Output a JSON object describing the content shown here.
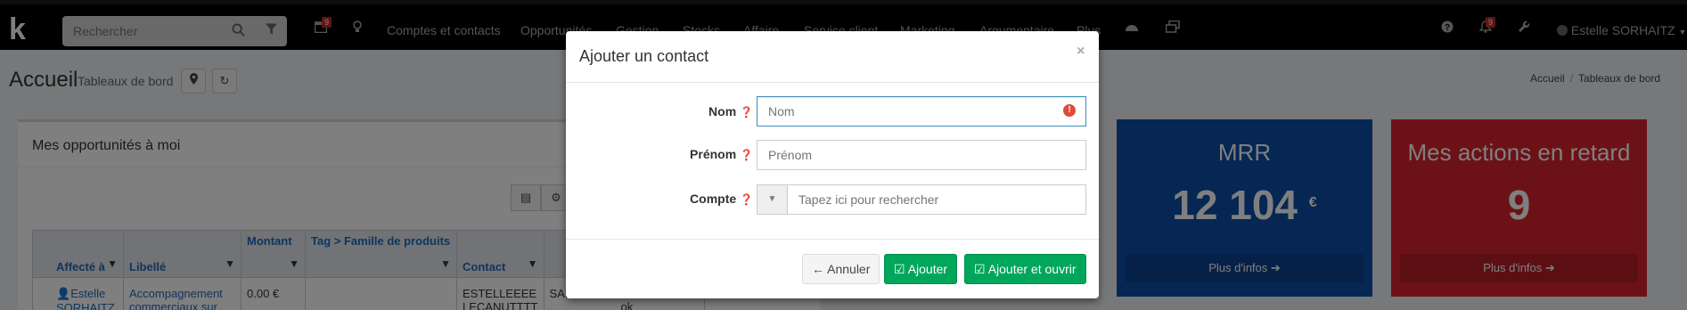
{
  "navbar": {
    "logo": "k",
    "search_placeholder": "Rechercher",
    "calendar_badge": "9",
    "menu": [
      "Comptes et contacts",
      "Opportunités",
      "Gestion",
      "Stocks",
      "Affaire",
      "Service client",
      "Marketing",
      "Argumentaire",
      "Plus"
    ],
    "notif_badge": "9",
    "user_name": "Estelle SORHAITZ"
  },
  "page": {
    "title": "Accueil",
    "subtitle": "Tableaux de bord",
    "breadcrumb": [
      "Accueil",
      "Tableaux de bord"
    ]
  },
  "opportunities_box": {
    "title": "Mes opportunités à moi",
    "columns": [
      "Affecté à",
      "Libellé",
      "Montant",
      "Tag > Famille de produits",
      "Contact",
      ""
    ],
    "row": {
      "affecte": "Estelle SORHAITZ",
      "libelle": "Accompagnement commerciaux sur",
      "montant": "0.00 €",
      "tag": "",
      "contact": "ESTELLEEEE LECANUTTTT",
      "compte": "SARL POUR"
    },
    "extra_cell": "ok"
  },
  "widgets": [
    {
      "title": "MRR",
      "value": "12 104",
      "unit": "€",
      "link": "Plus d'infos",
      "color": "#0d4fa8"
    },
    {
      "title": "Mes actions en retard",
      "value": "9",
      "unit": "",
      "link": "Plus d'infos",
      "color": "#d9242d"
    }
  ],
  "modal": {
    "title": "Ajouter un contact",
    "close": "×",
    "fields": {
      "nom": {
        "label": "Nom",
        "placeholder": "Nom"
      },
      "prenom": {
        "label": "Prénom",
        "placeholder": "Prénom"
      },
      "compte": {
        "label": "Compte",
        "placeholder": "Tapez ici pour rechercher"
      }
    },
    "buttons": {
      "cancel": "Annuler",
      "add": "Ajouter",
      "add_open": "Ajouter et ouvrir"
    }
  }
}
